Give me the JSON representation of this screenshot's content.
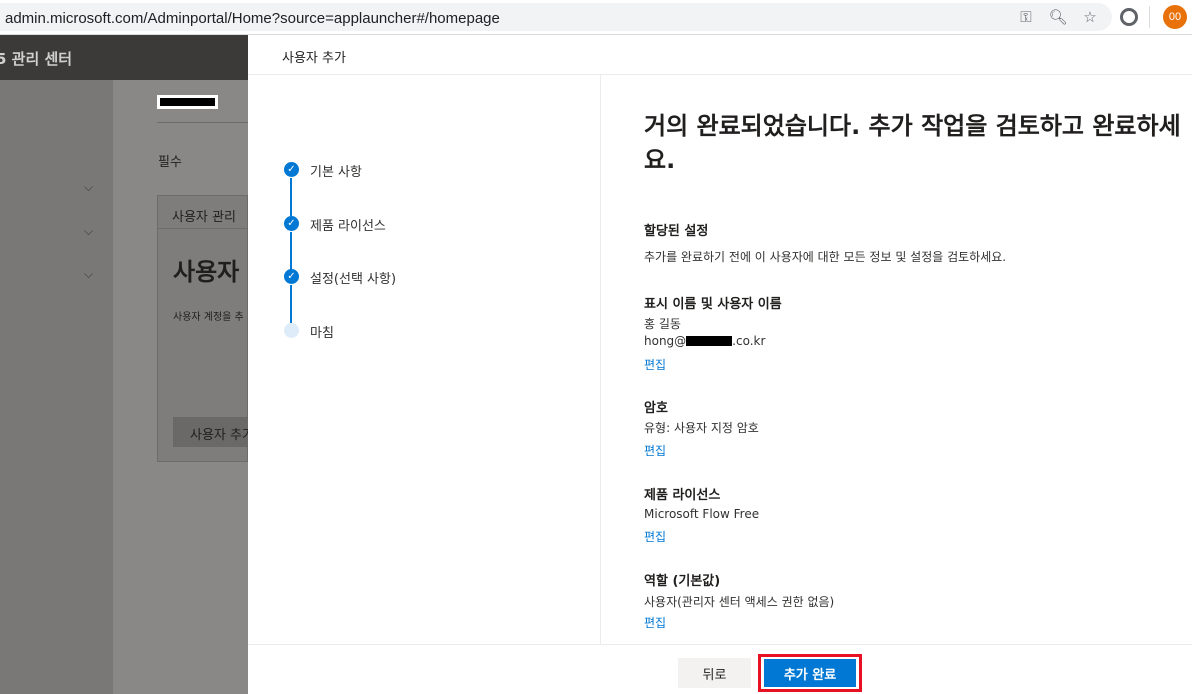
{
  "browser": {
    "url": "admin.microsoft.com/Adminportal/Home?source=applauncher#/homepage",
    "avatar_text": "00"
  },
  "background": {
    "app_title": "5 관리 센터",
    "required_label": "필수",
    "card_header": "사용자 관리",
    "card_big_text": "사용자",
    "card_small_text": "사용자 계정을 추",
    "card_button": "사용자 추가"
  },
  "panel": {
    "title": "사용자 추가",
    "steps": [
      {
        "label": "기본 사항",
        "done": true
      },
      {
        "label": "제품 라이선스",
        "done": true
      },
      {
        "label": "설정(선택 사항)",
        "done": true
      },
      {
        "label": "마침",
        "done": false
      }
    ],
    "heading": "거의 완료되었습니다. 추가 작업을 검토하고 완료하세요.",
    "assigned": {
      "title": "할당된 설정",
      "desc": "추가를 완료하기 전에 이 사용자에 대한 모든 정보 및 설정을 검토하세요."
    },
    "display_name": {
      "title": "표시 이름 및 사용자 이름",
      "name": "홍 길동",
      "email_prefix": "hong@",
      "email_suffix": ".co.kr",
      "edit": "편집"
    },
    "password": {
      "title": "암호",
      "type": "유형: 사용자 지정 암호",
      "edit": "편집"
    },
    "license": {
      "title": "제품 라이선스",
      "value": "Microsoft Flow Free",
      "edit": "편집"
    },
    "role": {
      "title": "역할 (기본값)",
      "value": "사용자(관리자 센터 액세스 권한 없음)",
      "edit": "편집"
    },
    "footer": {
      "back": "뒤로",
      "finish": "추가 완료"
    }
  },
  "colors": {
    "accent": "#0078d4",
    "highlight": "#e81123"
  }
}
